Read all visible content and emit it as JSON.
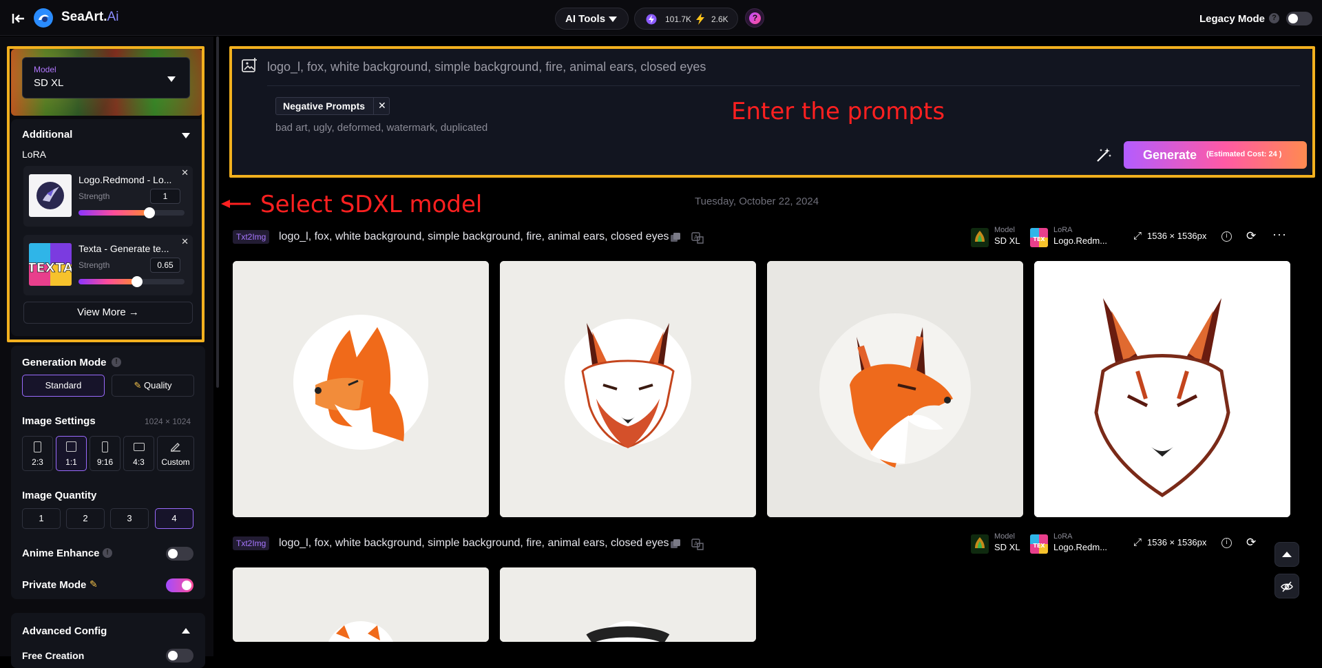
{
  "header": {
    "brand_name": "SeaArt.",
    "brand_suffix": "Ai",
    "ai_tools_label": "AI Tools",
    "credits_stamina": "101.7K",
    "credits_energy": "2.6K",
    "help_label": "?",
    "legacy_label": "Legacy Mode",
    "legacy_on": false
  },
  "sidebar": {
    "model": {
      "label": "Model",
      "value": "SD XL"
    },
    "additional": {
      "title": "Additional",
      "lora_label": "LoRA",
      "loras": [
        {
          "name": "Logo.Redmond - Lo...",
          "strength_label": "Strength",
          "strength_value": "1",
          "slider_percent": 67
        },
        {
          "name": "Texta - Generate te...",
          "strength_label": "Strength",
          "strength_value": "0.65",
          "slider_percent": 55
        }
      ],
      "view_more": "View More"
    },
    "generation": {
      "mode_title": "Generation Mode",
      "modes": [
        "Standard",
        "Quality"
      ],
      "selected_mode": "Standard",
      "image_settings_title": "Image Settings",
      "image_dims": "1024 × 1024",
      "ratios": [
        "2:3",
        "1:1",
        "9:16",
        "4:3",
        "Custom"
      ],
      "selected_ratio": "1:1",
      "quantity_title": "Image Quantity",
      "quantities": [
        "1",
        "2",
        "3",
        "4"
      ],
      "selected_quantity": "4",
      "anime_enhance_label": "Anime Enhance",
      "anime_enhance_on": false,
      "private_mode_label": "Private Mode",
      "private_mode_on": true
    },
    "advanced": {
      "title": "Advanced Config",
      "free_creation_label": "Free Creation"
    }
  },
  "prompt": {
    "text": "logo_l, fox, white background, simple background, fire, animal ears, closed eyes",
    "negative_chip": "Negative Prompts",
    "negative_text": "bad art, ugly, deformed, watermark, duplicated",
    "generate_label": "Generate",
    "estimated_cost": "(Estimated Cost: 24 )"
  },
  "annotations": {
    "prompt_note": "Enter the prompts",
    "model_note": "Select SDXL model"
  },
  "feed": {
    "date": "Tuesday, October 22, 2024",
    "tasks": [
      {
        "badge": "Txt2Img",
        "prompt": "logo_l, fox, white background, simple background, fire, animal ears, closed eyes",
        "model_label": "Model",
        "model_value": "SD XL",
        "lora_label": "LoRA",
        "lora_value": "Logo.Redm...",
        "resolution": "1536 × 1536px"
      },
      {
        "badge": "Txt2Img",
        "prompt": "logo_l, fox, white background, simple background, fire, animal ears, closed eyes",
        "model_label": "Model",
        "model_value": "SD XL",
        "lora_label": "LoRA",
        "lora_value": "Logo.Redm...",
        "resolution": "1536 × 1536px"
      }
    ]
  },
  "colors": {
    "accent": "#a24bff",
    "annotation_box": "#f2b01e",
    "annotation_text": "#ff2020",
    "generate_start": "#b35cff",
    "generate_end": "#ff8a50"
  }
}
